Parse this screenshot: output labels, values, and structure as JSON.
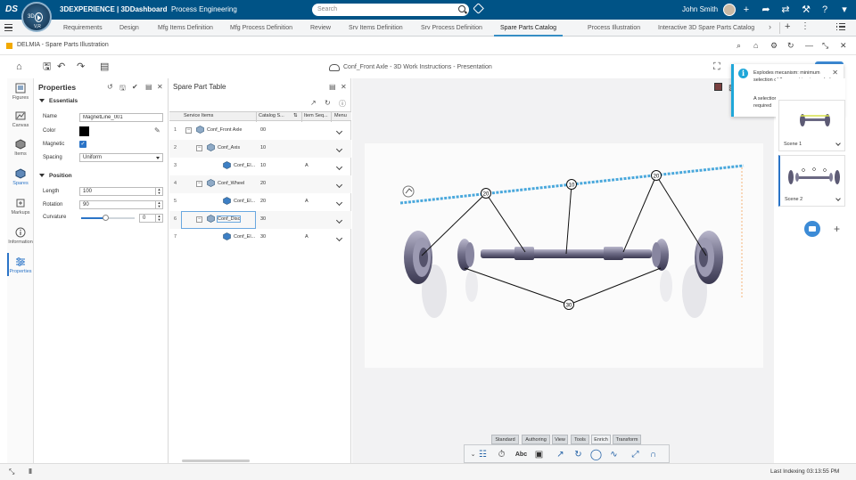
{
  "topbar": {
    "compass_label": "3D",
    "compass_version": "V,R",
    "brand_bold": "3DEXPERIENCE | 3DDashboard",
    "brand_rest": "Process Engineering",
    "search_placeholder": "Search",
    "user_name": "John Smith"
  },
  "tabs": [
    {
      "label": "Requirements"
    },
    {
      "label": "Design"
    },
    {
      "label": "Mfg Items Definition"
    },
    {
      "label": "Mfg Process Definition"
    },
    {
      "label": "Review"
    },
    {
      "label": "Srv Items Definition"
    },
    {
      "label": "Srv Process Definition"
    },
    {
      "label": "Spare Parts Catalog",
      "active": true
    },
    {
      "label": "Process Illustration"
    },
    {
      "label": "Interactive 3D Spare Parts Catalog"
    }
  ],
  "app": {
    "title": "DELMIA - Spare Parts Illustration",
    "doc_title": "Conf_Front Axle - 3D Work Instructions - Presentation"
  },
  "sidebar": {
    "items": [
      {
        "label": "Figures",
        "icon": "figures-icon"
      },
      {
        "label": "Canvas",
        "icon": "canvas-icon"
      },
      {
        "label": "Items",
        "icon": "items-icon"
      },
      {
        "label": "Spares",
        "icon": "spares-icon"
      },
      {
        "label": "Markups",
        "icon": "markups-icon"
      },
      {
        "label": "Information",
        "icon": "information-icon"
      },
      {
        "label": "Properties",
        "icon": "properties-icon",
        "active": true
      }
    ]
  },
  "properties": {
    "title": "Properties",
    "essentials_label": "Essentials",
    "name_label": "Name",
    "name_value": "MagnetLine_001",
    "color_label": "Color",
    "color_value": "#000000",
    "magnetic_label": "Magnetic",
    "magnetic_checked": true,
    "spacing_label": "Spacing",
    "spacing_value": "Uniform",
    "position_label": "Position",
    "length_label": "Length",
    "length_value": "100",
    "rotation_label": "Rotation",
    "rotation_value": "90",
    "curvature_label": "Curvature",
    "curvature_value": "0"
  },
  "spare_table": {
    "title": "Spare Part Table",
    "columns": [
      "Service Items",
      "Catalog S...",
      "Item Seq...",
      "Menu"
    ],
    "rows": [
      {
        "num": "1",
        "name": "Conf_Front Axle",
        "catalog": "00",
        "seq": "",
        "level": 0,
        "expander": "−"
      },
      {
        "num": "2",
        "name": "Conf_Axis",
        "catalog": "10",
        "seq": "",
        "level": 1,
        "expander": "−"
      },
      {
        "num": "3",
        "name": "Conf_El...",
        "catalog": "10",
        "seq": "A",
        "level": 2,
        "expander": ""
      },
      {
        "num": "4",
        "name": "Conf_Wheel",
        "catalog": "20",
        "seq": "",
        "level": 1,
        "expander": "−"
      },
      {
        "num": "5",
        "name": "Conf_El...",
        "catalog": "20",
        "seq": "A",
        "level": 2,
        "expander": ""
      },
      {
        "num": "6",
        "name": "Conf_Disc",
        "catalog": "30",
        "seq": "",
        "level": 1,
        "expander": "−",
        "selected": true
      },
      {
        "num": "7",
        "name": "Conf_El...",
        "catalog": "30",
        "seq": "A",
        "level": 2,
        "expander": ""
      }
    ]
  },
  "viewer": {
    "balloons": [
      "20",
      "10",
      "20",
      "30"
    ]
  },
  "notification": {
    "message": "Explodes mecanism: minimum selection of 2 geometries is needed",
    "detail": "A selection of at least 2 geometries is required"
  },
  "scenes": [
    {
      "label": "Scene 1"
    },
    {
      "label": "Scene 2",
      "active": true
    }
  ],
  "action_bar": {
    "tabs": [
      "Standard",
      "Authoring",
      "View",
      "Tools",
      "Enrich",
      "Transform"
    ],
    "active_tab": "Enrich",
    "text_tool_label": "Abc"
  },
  "status": {
    "text": "Last Indexing  03:13:55 PM"
  },
  "colors": {
    "brand": "#005386",
    "accent": "#2b74c7",
    "info": "#1fa7d9",
    "magnet_line": "#4aa8dc"
  }
}
